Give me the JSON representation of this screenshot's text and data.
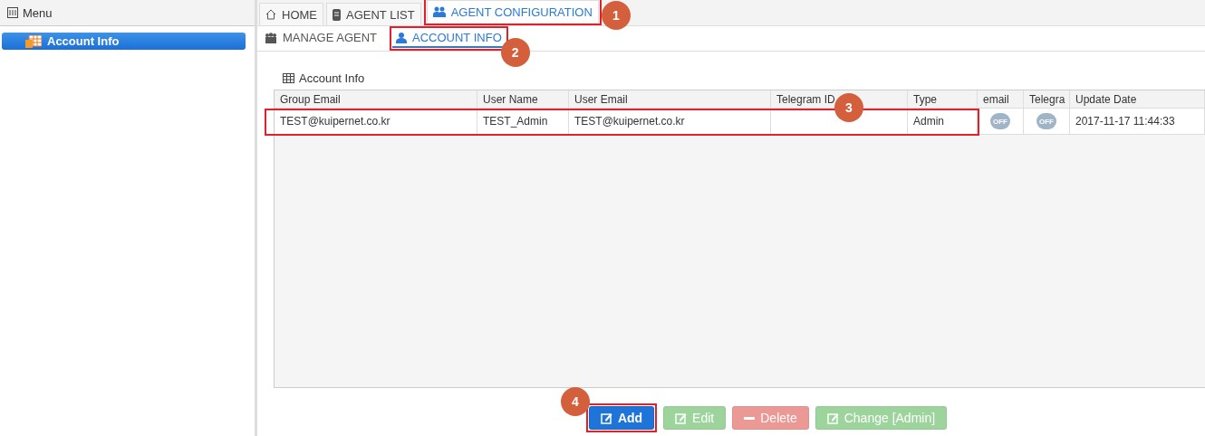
{
  "sidebar": {
    "title": "Menu",
    "items": [
      {
        "label": "Account Info",
        "selected": true
      }
    ]
  },
  "tabs": [
    {
      "label": "HOME",
      "selected": false
    },
    {
      "label": "AGENT LIST",
      "selected": false
    },
    {
      "label": "AGENT CONFIGURATION",
      "selected": true
    }
  ],
  "subtabs": [
    {
      "label": "MANAGE AGENT",
      "selected": false
    },
    {
      "label": "ACCOUNT INFO",
      "selected": true
    }
  ],
  "grid": {
    "title": "Account Info",
    "columns": [
      "Group Email",
      "User Name",
      "User Email",
      "Telegram ID",
      "Type",
      "email",
      "Telegra",
      "Update Date"
    ],
    "rows": [
      {
        "selected": false,
        "cells": [
          {
            "kind": "text",
            "text": "TEST@kuipernet.co.kr"
          },
          {
            "kind": "text",
            "text": "TEST_Admin"
          },
          {
            "kind": "text",
            "text": "TEST@kuipernet.co.kr"
          },
          {
            "kind": "text",
            "text": ""
          },
          {
            "kind": "text",
            "text": "Admin"
          },
          {
            "kind": "toggle",
            "on": false,
            "text": "OFF"
          },
          {
            "kind": "toggle",
            "on": false,
            "text": "OFF"
          },
          {
            "kind": "text",
            "text": "2017-11-17 11:44:33"
          }
        ]
      }
    ]
  },
  "buttons": [
    {
      "label": "Add",
      "kind": "primary",
      "disabled": false
    },
    {
      "label": "Edit",
      "kind": "success",
      "disabled": true
    },
    {
      "label": "Delete",
      "kind": "danger",
      "disabled": true
    },
    {
      "label": "Change [Admin]",
      "kind": "success",
      "disabled": true
    }
  ],
  "annotations": [
    {
      "number": "1"
    },
    {
      "number": "2"
    },
    {
      "number": "3"
    },
    {
      "number": "4"
    }
  ]
}
